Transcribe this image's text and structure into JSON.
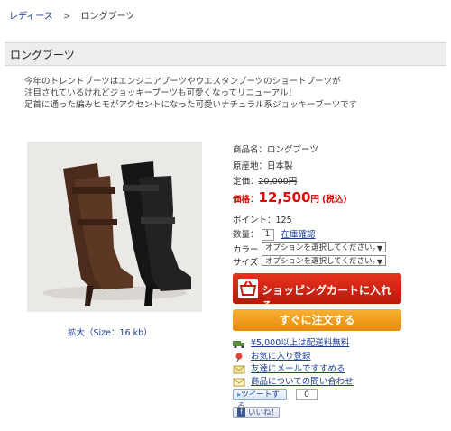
{
  "breadcrumb": {
    "parent": "レディース",
    "separator": ">",
    "current": "ロングブーツ"
  },
  "page_title": "ロングブーツ",
  "description": [
    "今年のトレンドブーツはエンジニアブーツやウエスタンブーツのショートブーツが",
    "注目されているけれどジョッキーブーツも可愛くなってリニューアル！",
    "足首に通った編みヒモがアクセントになった可愛いナチュラル系ジョッキーブーツです"
  ],
  "product_image": {
    "alt": "long-boots"
  },
  "zoom_link": "拡大（Size：16 kb）",
  "info": {
    "name_label": "商品名：",
    "name": "ロングブーツ",
    "origin_label": "原産地：",
    "origin": "日本製",
    "list_price_label": "定価：",
    "list_price": "20,000円",
    "price_label": "価格：",
    "price_value": "12,500",
    "price_unit": "円",
    "price_note": "(税込)",
    "points_label": "ポイント：",
    "points": "125",
    "qty_label": "数量：",
    "qty_value": "1",
    "stock_link": "在庫確認",
    "color_label": "カラー",
    "color_select": "オプションを選択してください。",
    "size_label": "サイズ",
    "size_select": "オプションを選択してください。"
  },
  "buttons": {
    "cart": "ショッピングカートに入れる",
    "order_now": "すぐに注文する"
  },
  "links": {
    "shipping": "¥5,000以上は配送料無料",
    "favorite": "お気に入り登録",
    "email_friend": "友達にメールですすめる",
    "inquiry": "商品についての問い合わせ"
  },
  "social": {
    "tweet": "ツイートする",
    "tweet_count": "0",
    "like": "いいね！"
  },
  "colors": {
    "cart_red": "#d42614",
    "order_orange": "#f2a020",
    "price_red": "#e00000",
    "link_blue": "#1a3d9c"
  }
}
